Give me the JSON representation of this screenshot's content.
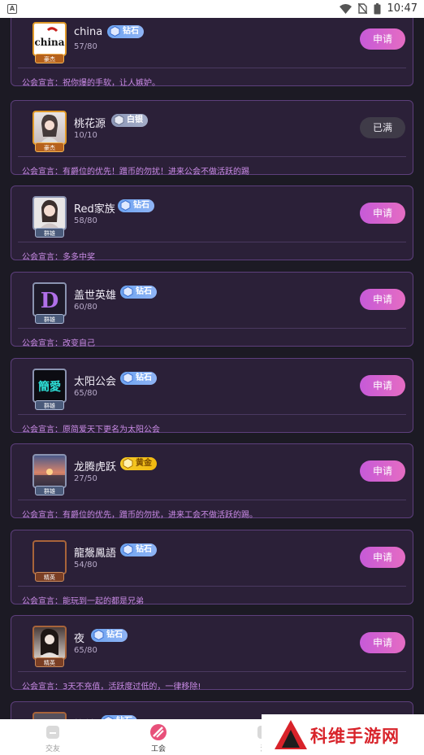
{
  "status_bar": {
    "time": "10:47"
  },
  "guilds": [
    {
      "name": "china",
      "level": "钻石",
      "level_type": "diamond",
      "count": "57/80",
      "motto": "公会宣言：祝你爆的手软，让人嫉妒。",
      "action": "申请",
      "badge": "豪杰",
      "avatar_text": "china"
    },
    {
      "name": "桃花源",
      "level": "白银",
      "level_type": "silver",
      "count": "10/10",
      "motto": "公会宣言：有爵位的优先！蹭币的勿扰！进来公会不做活跃的踢",
      "action": "已满",
      "badge": "豪杰",
      "avatar_text": ""
    },
    {
      "name": "Red家族",
      "level": "钻石",
      "level_type": "diamond",
      "count": "58/80",
      "motto": "公会宣言：多多中奖",
      "action": "申请",
      "badge": "群雄",
      "avatar_text": ""
    },
    {
      "name": "盖世英雄",
      "level": "钻石",
      "level_type": "diamond",
      "count": "60/80",
      "motto": "公会宣言：改变自己",
      "action": "申请",
      "badge": "群雄",
      "avatar_text": "D"
    },
    {
      "name": "太阳公会",
      "level": "钻石",
      "level_type": "diamond",
      "count": "65/80",
      "motto": "公会宣言：原简爱天下更名为太阳公会",
      "action": "申请",
      "badge": "群雄",
      "avatar_text": "簡愛"
    },
    {
      "name": "龙腾虎跃",
      "level": "黄金",
      "level_type": "gold",
      "count": "27/50",
      "motto": "公会宣言：有爵位的优先，蹭币的勿扰，进来工会不做活跃的踢。",
      "action": "申请",
      "badge": "群雄",
      "avatar_text": ""
    },
    {
      "name": "龍鬶鳳語",
      "level": "钻石",
      "level_type": "diamond",
      "count": "54/80",
      "motto": "公会宣言：能玩到一起的都是兄弟",
      "action": "申请",
      "badge": "精英",
      "avatar_text": ""
    },
    {
      "name": "夜",
      "level": "钻石",
      "level_type": "diamond",
      "count": "65/80",
      "motto": "公会宣言：3天不充值，活跃度过低的，一律移除!",
      "action": "申请",
      "badge": "精英",
      "avatar_text": ""
    },
    {
      "name": "笑傲",
      "level": "钻石",
      "level_type": "diamond",
      "count": "",
      "motto": "",
      "action": "",
      "badge": "",
      "avatar_text": ""
    }
  ],
  "tabbar": {
    "tabs": [
      {
        "label": "交友",
        "icon": "friends-icon"
      },
      {
        "label": "工会",
        "icon": "guild-icon"
      },
      {
        "label": "消",
        "icon": "message-icon"
      }
    ]
  },
  "watermark": {
    "text": "科维手游网"
  },
  "colors": {
    "apply_button": "#d462cf",
    "full_button": "#3f3b48",
    "card_border": "#5d3f7c",
    "motto": "#c98be5",
    "diamond": "#6ea4f0",
    "gold": "#f6cc28",
    "silver": "#8d98b8"
  }
}
